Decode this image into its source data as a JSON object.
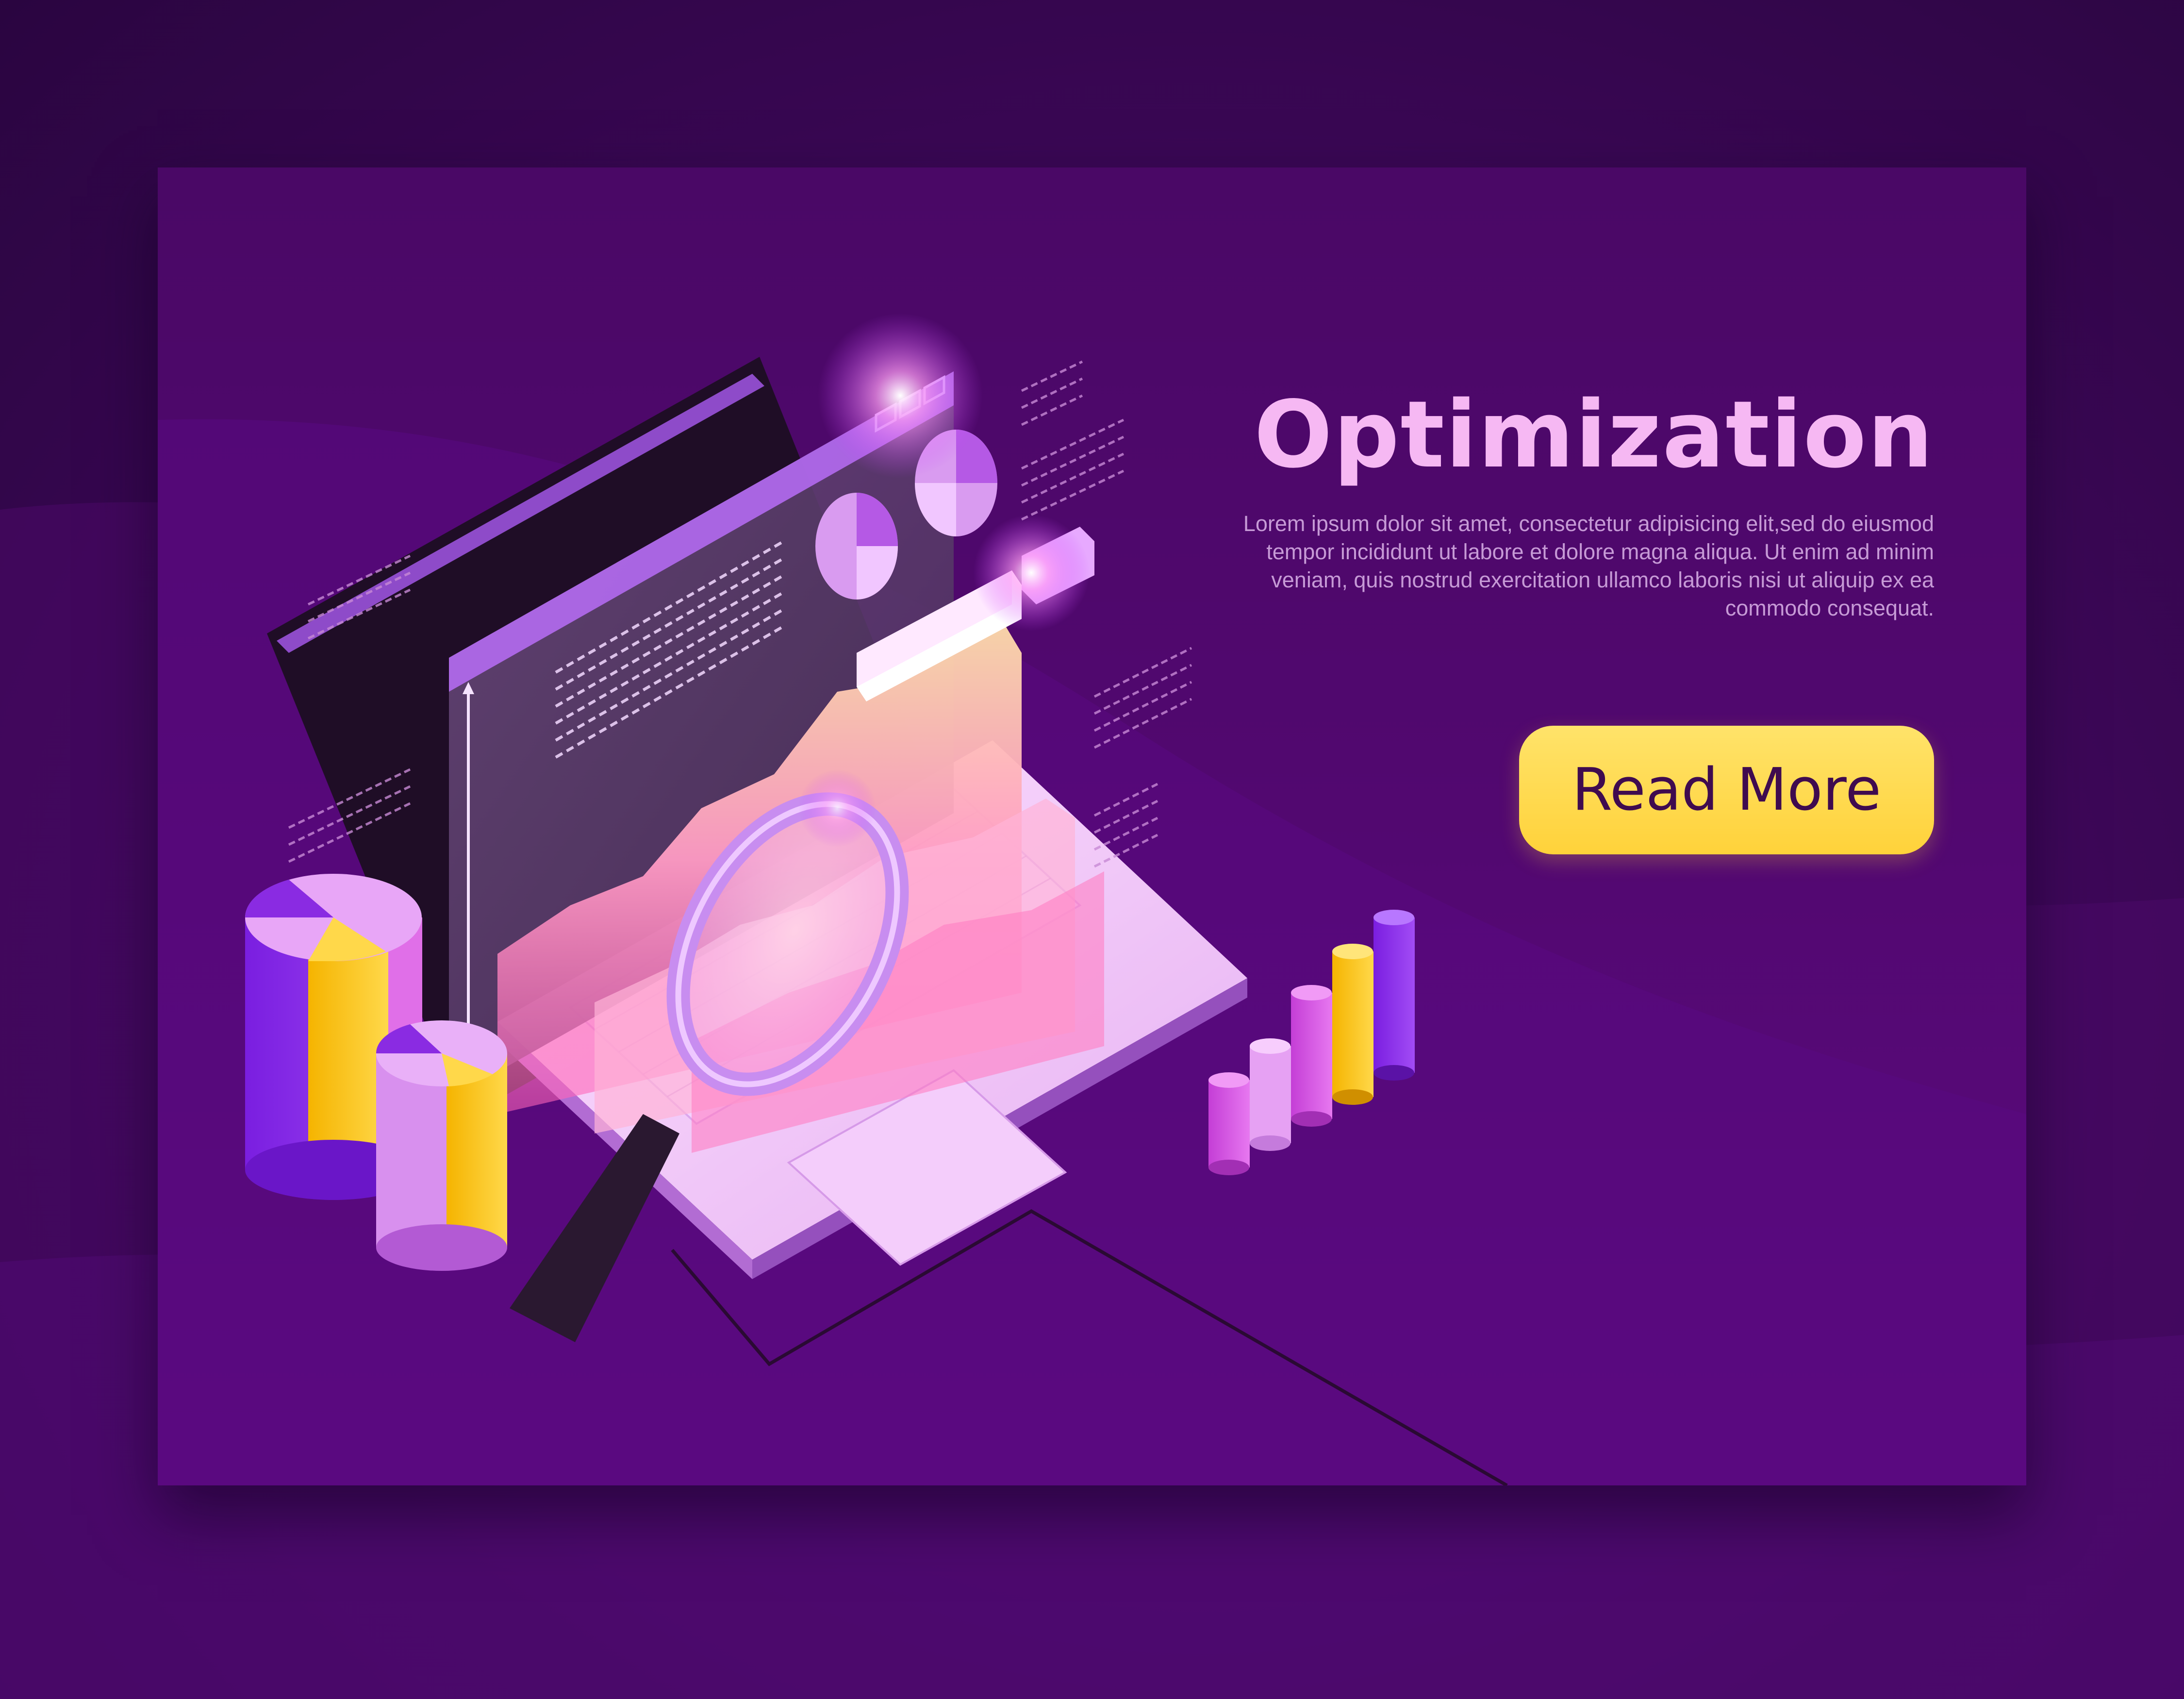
{
  "banner": {
    "title": "Optimization",
    "body": "Lorem ipsum dolor sit amet, consectetur adipisicing  elit,sed do eiusmod tempor incididunt ut labore et dolore magna aliqua. Ut enim ad minim veniam, quis nostrud exercitation ullamco laboris nisi ut aliquip ex ea commodo consequat.",
    "cta_label": "Read More"
  },
  "colors": {
    "background": "#3a0a52",
    "banner": "#51086f",
    "title": "#f6b8f3",
    "body_text": "#c69ad6",
    "button": "#ffd23a",
    "button_text": "#3f0b4f",
    "accent_violet": "#8a2be2",
    "accent_yellow": "#f5b400"
  },
  "illustration": {
    "subject": "isometric laptop with analytics screen",
    "icons": [
      "laptop-icon",
      "magnifier-icon",
      "pie-chart-icon",
      "bar-chart-icon",
      "area-chart-icon"
    ]
  }
}
